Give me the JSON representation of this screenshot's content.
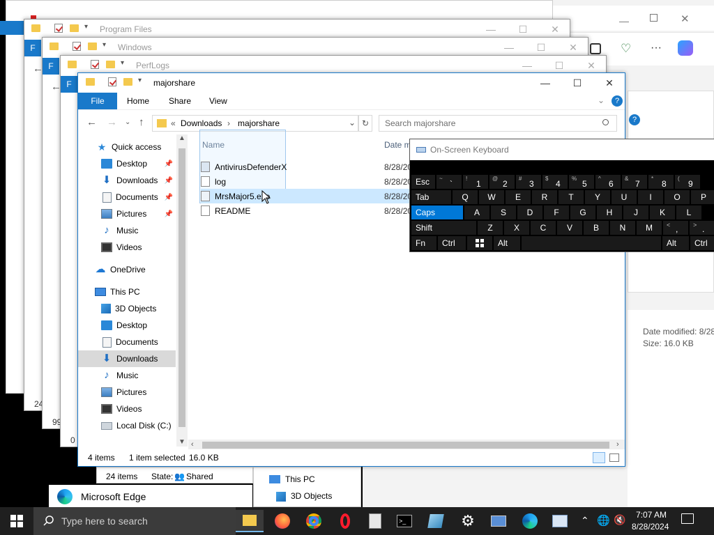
{
  "windows": {
    "program_files": {
      "title": "Program Files"
    },
    "windows_folder": {
      "title": "Windows"
    },
    "perflogs": {
      "title": "PerfLogs",
      "status_count": "0 i"
    },
    "majorshare": {
      "title": "majorshare"
    },
    "back_win1": {
      "status_count": "24",
      "left_count": "24"
    },
    "back_win2": {
      "status_count": "99"
    }
  },
  "explorer": {
    "title": "majorshare",
    "tabs": {
      "file": "File",
      "home": "Home",
      "share": "Share",
      "view": "View"
    },
    "address": {
      "prefix": "«",
      "crumb1": "Downloads",
      "sep": "›",
      "crumb2": "majorshare"
    },
    "search_placeholder": "Search majorshare",
    "columns": {
      "name": "Name",
      "date": "Date m"
    },
    "files": [
      {
        "name": "AntivirusDefenderX",
        "date": "8/28/20"
      },
      {
        "name": "log",
        "date": "8/28/20"
      },
      {
        "name": "MrsMajor5.exe",
        "date": "8/28/20"
      },
      {
        "name": "README",
        "date": "8/28/20"
      }
    ],
    "nav": {
      "quick_access": "Quick access",
      "desktop": "Desktop",
      "downloads": "Downloads",
      "documents": "Documents",
      "pictures": "Pictures",
      "music": "Music",
      "videos": "Videos",
      "onedrive": "OneDrive",
      "this_pc": "This PC",
      "objects3d": "3D Objects",
      "desktop2": "Desktop",
      "documents2": "Documents",
      "downloads2": "Downloads",
      "music2": "Music",
      "pictures2": "Pictures",
      "videos2": "Videos",
      "local_disk": "Local Disk (C:)"
    },
    "status": {
      "items": "4 items",
      "selected": "1 item selected",
      "size": "16.0 KB"
    }
  },
  "behind_explorer": {
    "status_items": "24 items",
    "status_state": "State:",
    "status_shared": "Shared",
    "nav_this_pc": "This PC",
    "nav_3d": "3D Objects"
  },
  "edge": {
    "label": "Microsoft Edge",
    "details_date_label": "Date modified: 8/28",
    "details_size_label": "Size: 16.0 KB"
  },
  "osk": {
    "title": "On-Screen Keyboard",
    "row1": [
      {
        "label": "Esc"
      },
      {
        "sub": "~",
        "main": "`"
      },
      {
        "sub": "!",
        "main": "1"
      },
      {
        "sub": "@",
        "main": "2"
      },
      {
        "sub": "#",
        "main": "3"
      },
      {
        "sub": "$",
        "main": "4"
      },
      {
        "sub": "%",
        "main": "5"
      },
      {
        "sub": "^",
        "main": "6"
      },
      {
        "sub": "&",
        "main": "7"
      },
      {
        "sub": "*",
        "main": "8"
      },
      {
        "sub": "(",
        "main": "9"
      }
    ],
    "row2": [
      "Tab",
      "Q",
      "W",
      "E",
      "R",
      "T",
      "Y",
      "U",
      "I",
      "O",
      "P"
    ],
    "row3": [
      "Caps",
      "A",
      "S",
      "D",
      "F",
      "G",
      "H",
      "J",
      "K",
      "L"
    ],
    "row4": [
      "Shift",
      "Z",
      "X",
      "C",
      "V",
      "B",
      "N",
      "M",
      "<",
      ">"
    ],
    "row4_sub": [
      "",
      "",
      "",
      "",
      "",
      "",
      "",
      "",
      ",",
      "."
    ],
    "row5": [
      "Fn",
      "Ctrl",
      "",
      "Alt",
      "",
      "Alt",
      "Ctrl"
    ]
  },
  "taskbar": {
    "search_placeholder": "Type here to search",
    "time": "7:07 AM",
    "date": "8/28/2024"
  },
  "colors": {
    "accent": "#1979ca",
    "taskbar": "#1f1f1f",
    "caps_active": "#0078d7"
  }
}
